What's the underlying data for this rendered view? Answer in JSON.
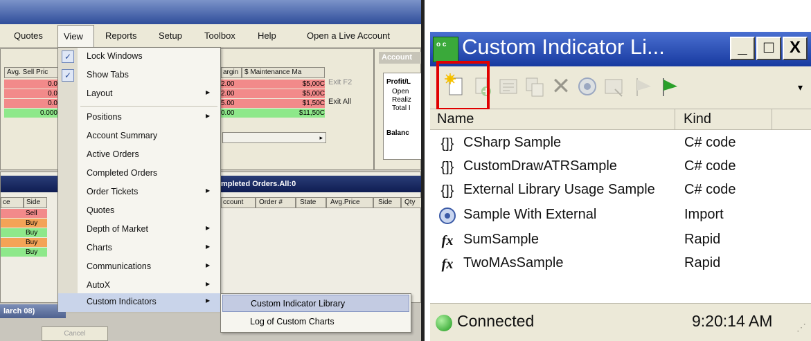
{
  "left_app": {
    "menu_bar": [
      "Quotes",
      "View",
      "Reports",
      "Setup",
      "Toolbox",
      "Help",
      "Open a Live Account"
    ],
    "account_panel_title": "Account",
    "positions_grid": {
      "header_avg_sell": "Avg. Sell Pric",
      "header_margin": "argin",
      "header_maintenance": "$ Maintenance Ma",
      "rows": [
        {
          "left_value": "0.0",
          "margin": "2.00",
          "maintenance": "$5,00C"
        },
        {
          "left_value": "0.0",
          "margin": "2.00",
          "maintenance": "$5,00C"
        },
        {
          "left_value": "0.0",
          "margin": "5.00",
          "maintenance": "$1,50C"
        },
        {
          "left_value": "0.000",
          "margin": "0.00",
          "maintenance": "$11,50C"
        }
      ],
      "exit_f2": "Exit F2",
      "exit_all": "Exit All"
    },
    "account_summary_side": {
      "profit": "Profit/L",
      "open": "Open",
      "realized": "Realiz",
      "total": "Total I",
      "balance": "Balanc"
    },
    "completed_orders_title": "mpleted Orders.All:0",
    "completed_orders_headers": [
      "ccount",
      "Order #",
      "State",
      "Avg.Price",
      "Side",
      "Qty"
    ],
    "orders_left_headers": [
      "ce",
      "Side"
    ],
    "orders_left_sides": [
      "Sell",
      "Buy",
      "Buy",
      "Buy",
      "Buy"
    ],
    "bottom_bar_text": "larch 08)",
    "bottom_button": "Cancel",
    "view_menu": {
      "items": [
        {
          "label": "Lock Windows",
          "checked": true,
          "submenu": false
        },
        {
          "label": "Show Tabs",
          "checked": true,
          "submenu": false
        },
        {
          "label": "Layout",
          "checked": false,
          "submenu": true
        },
        {
          "label": "Positions",
          "checked": false,
          "submenu": true
        },
        {
          "label": "Account Summary",
          "checked": false,
          "submenu": false
        },
        {
          "label": "Active Orders",
          "checked": false,
          "submenu": false
        },
        {
          "label": "Completed Orders",
          "checked": false,
          "submenu": false
        },
        {
          "label": "Order Tickets",
          "checked": false,
          "submenu": true
        },
        {
          "label": "Quotes",
          "checked": false,
          "submenu": false
        },
        {
          "label": "Depth of Market",
          "checked": false,
          "submenu": true
        },
        {
          "label": "Charts",
          "checked": false,
          "submenu": true
        },
        {
          "label": "Communications",
          "checked": false,
          "submenu": true
        },
        {
          "label": "AutoX",
          "checked": false,
          "submenu": true
        },
        {
          "label": "Custom Indicators",
          "checked": false,
          "submenu": true
        }
      ],
      "custom_indicators_submenu": [
        "Custom Indicator Library",
        "Log of Custom Charts"
      ]
    }
  },
  "right_window": {
    "title": "Custom Indicator Li...",
    "app_icon_text": "o c",
    "window_buttons": [
      "_",
      "□",
      "X"
    ],
    "toolbar_icons": [
      "new-indicator-icon",
      "add-icon",
      "edit-icon",
      "copy-icon",
      "delete-icon",
      "import-icon",
      "view-icon",
      "apply-grey-icon",
      "apply-green-icon"
    ],
    "columns": [
      "Name",
      "Kind"
    ],
    "rows": [
      {
        "icon": "code-icon",
        "name": "CSharp Sample",
        "kind": "C# code"
      },
      {
        "icon": "code-icon",
        "name": "CustomDrawATRSample",
        "kind": "C# code"
      },
      {
        "icon": "code-icon",
        "name": "External Library Usage Sample",
        "kind": "C# code"
      },
      {
        "icon": "import-icon",
        "name": "Sample With External",
        "kind": "Import"
      },
      {
        "icon": "fx-icon",
        "name": "SumSample",
        "kind": "Rapid"
      },
      {
        "icon": "fx-icon",
        "name": "TwoMAsSample",
        "kind": "Rapid"
      }
    ],
    "status": {
      "text": "Connected",
      "time": "9:20:14 AM",
      "color": "#1d9a1d"
    }
  }
}
